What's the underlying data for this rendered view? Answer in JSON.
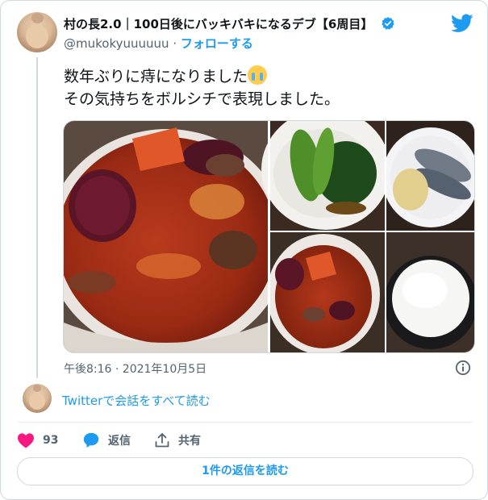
{
  "author": {
    "display_name": "村の長2.0｜100日後にバッキバキになるデブ【6周目】",
    "handle": "@mukokyuuuuuu",
    "separator": "·",
    "follow_label": "フォローする",
    "verified": true
  },
  "tweet": {
    "lines": [
      "数年ぶりに痔になりました",
      "その気持ちをボルシチで表現しました。"
    ],
    "emoji": "loudly-crying-face",
    "timestamp": "午後8:16 · 2021年10月5日"
  },
  "conversation": {
    "read_label": "Twitterで会話をすべて読む"
  },
  "actions": {
    "like_count": "93",
    "reply_label": "返信",
    "share_label": "共有"
  },
  "replies_button": "1件の返信を読む",
  "colors": {
    "accent": "#1d9bf0",
    "like": "#f91880",
    "text": "#0f1419",
    "muted": "#536471",
    "border": "#cfd9de"
  }
}
